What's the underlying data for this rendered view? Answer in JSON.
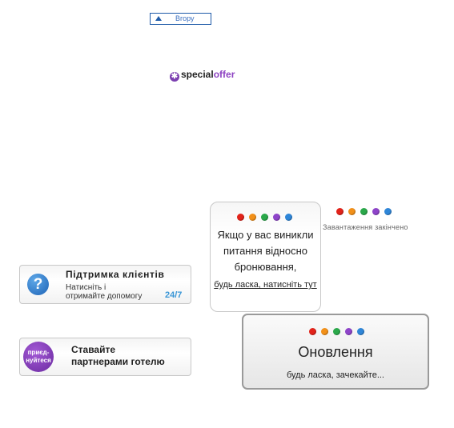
{
  "top_button": {
    "label": "Вгору",
    "icon": "triangle-up-icon"
  },
  "special_offer": {
    "word1": "special",
    "word2": "offer",
    "icon": "star-icon"
  },
  "dot_colors": [
    "#e2231a",
    "#f29019",
    "#2aa84a",
    "#8e44c9",
    "#2f86d8"
  ],
  "question_card": {
    "text": "Якщо у вас виникли питання відносно бронювання,",
    "link": "будь ласка, натисніть тут"
  },
  "loading": {
    "text": "Завантаження закінчено"
  },
  "support_banner": {
    "title": "Підтримка клієнтів",
    "line1": "Натисніть і",
    "line2": "отримайте допомогу",
    "hours": "24/7",
    "icon_text": "?"
  },
  "partner_banner": {
    "badge_line1": "приєд-",
    "badge_line2": "нуйтеся",
    "title_line1": "Ставайте",
    "title_line2": "партнерами готелю"
  },
  "update_box": {
    "title": "Оновлення",
    "subtitle": "будь ласка, зачекайте..."
  }
}
